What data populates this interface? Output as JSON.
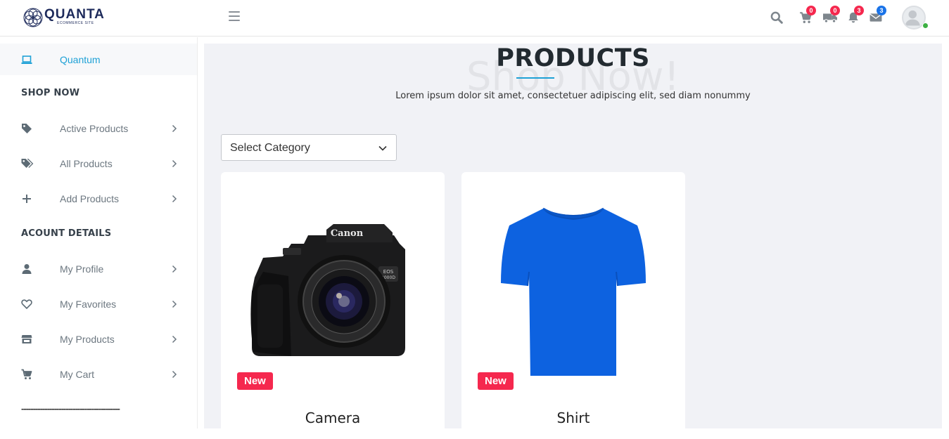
{
  "header": {
    "logo_text": "QUANTA",
    "logo_subtitle": "ECOMMERCE SITE",
    "icons": [
      {
        "name": "search-icon"
      },
      {
        "name": "cart-icon",
        "badge": "0",
        "badge_color": "#f5284e"
      },
      {
        "name": "truck-icon",
        "badge": "0",
        "badge_color": "#f5284e"
      },
      {
        "name": "bell-icon",
        "badge": "3",
        "badge_color": "#f5284e"
      },
      {
        "name": "envelope-icon",
        "badge": "3",
        "badge_color": "#1a73e8"
      }
    ],
    "avatar_status_color": "#3cb043"
  },
  "sidebar": {
    "active_item": {
      "label": "Quantum",
      "icon": "laptop-icon",
      "color": "#1ea1d6"
    },
    "sections": [
      {
        "heading": "SHOP NOW",
        "items": [
          {
            "label": "Active Products",
            "icon": "tag-icon"
          },
          {
            "label": "All Products",
            "icon": "tags-icon"
          },
          {
            "label": "Add Products",
            "icon": "plus-icon"
          }
        ]
      },
      {
        "heading": "ACOUNT DETAILS",
        "items": [
          {
            "label": "My Profile",
            "icon": "user-icon"
          },
          {
            "label": "My Favorites",
            "icon": "heart-icon"
          },
          {
            "label": "My Products",
            "icon": "store-icon"
          },
          {
            "label": "My Cart",
            "icon": "cart-icon"
          }
        ]
      }
    ],
    "divider_text": "------------------------------------------"
  },
  "main": {
    "ghost_text": "Shop Now!",
    "title": "PRODUCTS",
    "subtitle": "Lorem ipsum dolor sit amet, consectetuer adipiscing elit, sed diam nonummy",
    "category_select": {
      "value": "Select Category"
    },
    "products": [
      {
        "name": "Camera",
        "badge": "New"
      },
      {
        "name": "Shirt",
        "badge": "New"
      }
    ],
    "accent_color": "#1ea1d6",
    "badge_color": "#f5284e"
  }
}
